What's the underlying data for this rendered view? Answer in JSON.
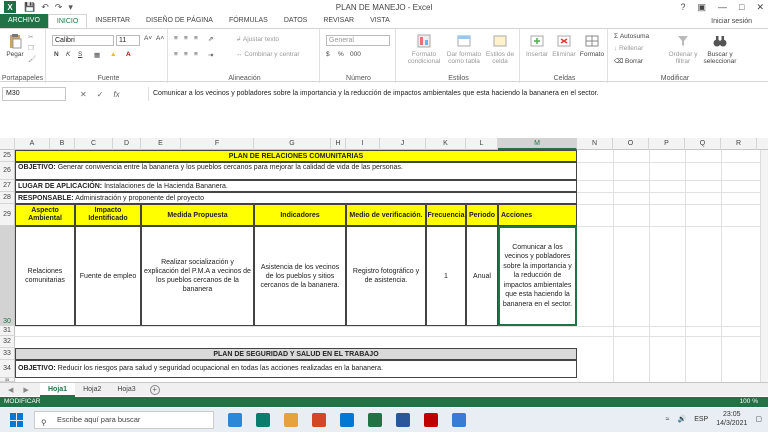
{
  "window": {
    "title": "PLAN DE MANEJO - Excel",
    "help": "?",
    "signin": "Iniciar sesión"
  },
  "ribbon_tabs": [
    "ARCHIVO",
    "INICIO",
    "INSERTAR",
    "DISEÑO DE PÁGINA",
    "FÓRMULAS",
    "DATOS",
    "REVISAR",
    "VISTA"
  ],
  "clipboard": {
    "paste": "Pegar",
    "label": "Portapapeles"
  },
  "font": {
    "name": "Calibri",
    "size": "11",
    "bold": "N",
    "italic": "K",
    "underline": "S",
    "label": "Fuente"
  },
  "alignment": {
    "wrap": "Ajustar texto",
    "merge": "Combinar y centrar",
    "label": "Alineación"
  },
  "number": {
    "format": "General",
    "label": "Número"
  },
  "styles": {
    "conditional": "Formato condicional",
    "table": "Dar formato como tabla",
    "cell": "Estilos de celda",
    "label": "Estilos"
  },
  "cells": {
    "insert": "Insertar",
    "delete": "Eliminar",
    "format": "Formato",
    "label": "Celdas"
  },
  "editing": {
    "autosum": "Autosuma",
    "fill": "Rellenar",
    "clear": "Borrar",
    "sort": "Ordenar y filtrar",
    "find": "Buscar y seleccionar",
    "label": "Modificar"
  },
  "formula_bar": {
    "namebox": "M30",
    "fx": "fx",
    "content": "Comunicar a los vecinos y pobladores sobre la importancia y la reducción de impactos ambientales que esta haciendo la bananera en el sector."
  },
  "columns": [
    "A",
    "B",
    "C",
    "D",
    "E",
    "F",
    "G",
    "H",
    "I",
    "J",
    "K",
    "L",
    "M",
    "N",
    "O",
    "P",
    "Q",
    "R"
  ],
  "rows": [
    "25",
    "26",
    "27",
    "28",
    "29",
    "30",
    "31",
    "32",
    "33",
    "34",
    "35"
  ],
  "sheet": {
    "plan1_title": "PLAN DE RELACIONES COMUNITARIAS",
    "plan1_objetivo_label": "OBJETIVO:",
    "plan1_objetivo": "Generar convivencia entre la bananera y los pueblos cercanos para mejorar la calidad de vida de las personas.",
    "lugar_label": "LUGAR DE APLICACIÓN:",
    "lugar": "Instalaciones de la Hacienda Bananera.",
    "responsable_label": "RESPONSABLE:",
    "responsable": "Administración y proponente del proyecto",
    "headers": [
      "Aspecto Ambiental",
      "Impacto Identificado",
      "Medida Propuesta",
      "Indicadores",
      "Medio de verificación.",
      "Frecuencia",
      "Periodo",
      "Acciones"
    ],
    "row30": [
      "Relaciones comunitarias",
      "Fuente de empleo",
      "Realizar socialización y explicación del P.M.A a vecinos de los pueblos cercanos de la bananera",
      "Asistencia de los vecinos de los pueblos y sitios cercanos de la bananera.",
      "Registro fotográfico y de asistencia.",
      "1",
      "Anual",
      "Comunicar a los vecinos y pobladores sobre la importancia y la reducción de impactos ambientales que esta haciendo la bananera en el sector."
    ],
    "plan2_title": "PLAN DE SEGURIDAD Y SALUD EN EL TRABAJO",
    "plan2_objetivo_label": "OBJETIVO:",
    "plan2_objetivo": "Reducir los riesgos para salud y seguridad ocupacional en todas las acciones realizadas en la bananera."
  },
  "sheet_tabs": [
    "Hoja1",
    "Hoja2",
    "Hoja3"
  ],
  "status": {
    "mode": "MODIFICAR",
    "zoom": "100 %"
  },
  "taskbar": {
    "search": "Escribe aquí para buscar",
    "lang": "ESP",
    "time": "23:05",
    "date": "14/3/2021"
  }
}
